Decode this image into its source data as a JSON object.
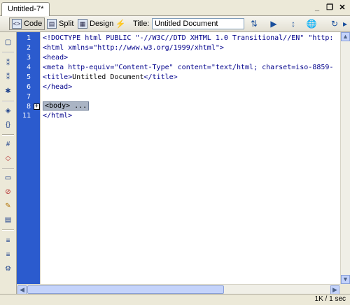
{
  "tab": {
    "title": "Untitled-7*"
  },
  "window_controls": {
    "minimize": "_",
    "restore": "❐",
    "close": "✕"
  },
  "toolbar": {
    "code_label": "Code",
    "split_label": "Split",
    "design_label": "Design",
    "title_label": "Title:",
    "title_value": "Untitled Document"
  },
  "gutter": {
    "lines": [
      "1",
      "2",
      "3",
      "4",
      "5",
      "6",
      "7",
      "8",
      "11"
    ]
  },
  "code": {
    "line1": "<!DOCTYPE html PUBLIC \"-//W3C//DTD XHTML 1.0 Transitional//EN\" \"http:",
    "line2": "<html xmlns=\"http://www.w3.org/1999/xhtml\">",
    "line3": "<head>",
    "line4": "<meta http-equiv=\"Content-Type\" content=\"text/html; charset=iso-8859-",
    "line5_open": "<title>",
    "line5_text": "Untitled Document",
    "line5_close": "</title>",
    "line6": "</head>",
    "line7": "",
    "line8_collapsed": "<body> ...",
    "line11": "</html>"
  },
  "status": {
    "text": "1K / 1 sec"
  },
  "colors": {
    "gutter": "#2b5bce",
    "tag": "#00008b",
    "collapsed_bg": "#aab4c4"
  }
}
